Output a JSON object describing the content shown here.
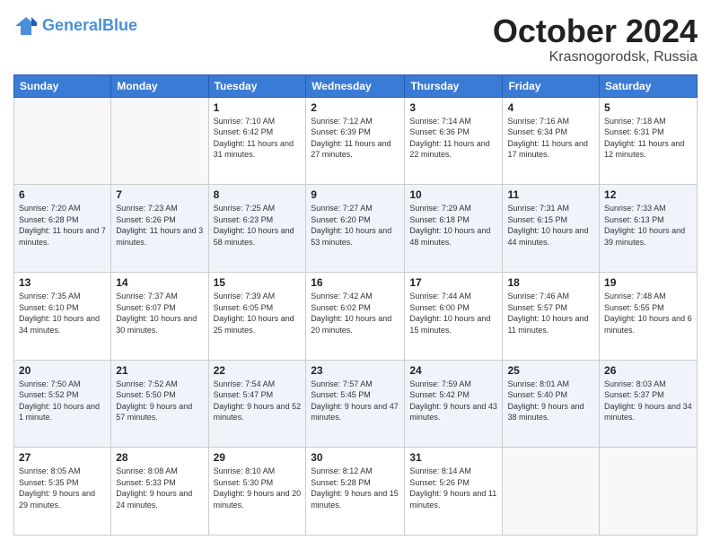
{
  "header": {
    "logo_line1": "General",
    "logo_line2": "Blue",
    "month": "October 2024",
    "location": "Krasnogorodsk, Russia"
  },
  "weekdays": [
    "Sunday",
    "Monday",
    "Tuesday",
    "Wednesday",
    "Thursday",
    "Friday",
    "Saturday"
  ],
  "weeks": [
    [
      {
        "day": "",
        "info": ""
      },
      {
        "day": "",
        "info": ""
      },
      {
        "day": "1",
        "info": "Sunrise: 7:10 AM\nSunset: 6:42 PM\nDaylight: 11 hours\nand 31 minutes."
      },
      {
        "day": "2",
        "info": "Sunrise: 7:12 AM\nSunset: 6:39 PM\nDaylight: 11 hours\nand 27 minutes."
      },
      {
        "day": "3",
        "info": "Sunrise: 7:14 AM\nSunset: 6:36 PM\nDaylight: 11 hours\nand 22 minutes."
      },
      {
        "day": "4",
        "info": "Sunrise: 7:16 AM\nSunset: 6:34 PM\nDaylight: 11 hours\nand 17 minutes."
      },
      {
        "day": "5",
        "info": "Sunrise: 7:18 AM\nSunset: 6:31 PM\nDaylight: 11 hours\nand 12 minutes."
      }
    ],
    [
      {
        "day": "6",
        "info": "Sunrise: 7:20 AM\nSunset: 6:28 PM\nDaylight: 11 hours\nand 7 minutes."
      },
      {
        "day": "7",
        "info": "Sunrise: 7:23 AM\nSunset: 6:26 PM\nDaylight: 11 hours\nand 3 minutes."
      },
      {
        "day": "8",
        "info": "Sunrise: 7:25 AM\nSunset: 6:23 PM\nDaylight: 10 hours\nand 58 minutes."
      },
      {
        "day": "9",
        "info": "Sunrise: 7:27 AM\nSunset: 6:20 PM\nDaylight: 10 hours\nand 53 minutes."
      },
      {
        "day": "10",
        "info": "Sunrise: 7:29 AM\nSunset: 6:18 PM\nDaylight: 10 hours\nand 48 minutes."
      },
      {
        "day": "11",
        "info": "Sunrise: 7:31 AM\nSunset: 6:15 PM\nDaylight: 10 hours\nand 44 minutes."
      },
      {
        "day": "12",
        "info": "Sunrise: 7:33 AM\nSunset: 6:13 PM\nDaylight: 10 hours\nand 39 minutes."
      }
    ],
    [
      {
        "day": "13",
        "info": "Sunrise: 7:35 AM\nSunset: 6:10 PM\nDaylight: 10 hours\nand 34 minutes."
      },
      {
        "day": "14",
        "info": "Sunrise: 7:37 AM\nSunset: 6:07 PM\nDaylight: 10 hours\nand 30 minutes."
      },
      {
        "day": "15",
        "info": "Sunrise: 7:39 AM\nSunset: 6:05 PM\nDaylight: 10 hours\nand 25 minutes."
      },
      {
        "day": "16",
        "info": "Sunrise: 7:42 AM\nSunset: 6:02 PM\nDaylight: 10 hours\nand 20 minutes."
      },
      {
        "day": "17",
        "info": "Sunrise: 7:44 AM\nSunset: 6:00 PM\nDaylight: 10 hours\nand 15 minutes."
      },
      {
        "day": "18",
        "info": "Sunrise: 7:46 AM\nSunset: 5:57 PM\nDaylight: 10 hours\nand 11 minutes."
      },
      {
        "day": "19",
        "info": "Sunrise: 7:48 AM\nSunset: 5:55 PM\nDaylight: 10 hours\nand 6 minutes."
      }
    ],
    [
      {
        "day": "20",
        "info": "Sunrise: 7:50 AM\nSunset: 5:52 PM\nDaylight: 10 hours\nand 1 minute."
      },
      {
        "day": "21",
        "info": "Sunrise: 7:52 AM\nSunset: 5:50 PM\nDaylight: 9 hours\nand 57 minutes."
      },
      {
        "day": "22",
        "info": "Sunrise: 7:54 AM\nSunset: 5:47 PM\nDaylight: 9 hours\nand 52 minutes."
      },
      {
        "day": "23",
        "info": "Sunrise: 7:57 AM\nSunset: 5:45 PM\nDaylight: 9 hours\nand 47 minutes."
      },
      {
        "day": "24",
        "info": "Sunrise: 7:59 AM\nSunset: 5:42 PM\nDaylight: 9 hours\nand 43 minutes."
      },
      {
        "day": "25",
        "info": "Sunrise: 8:01 AM\nSunset: 5:40 PM\nDaylight: 9 hours\nand 38 minutes."
      },
      {
        "day": "26",
        "info": "Sunrise: 8:03 AM\nSunset: 5:37 PM\nDaylight: 9 hours\nand 34 minutes."
      }
    ],
    [
      {
        "day": "27",
        "info": "Sunrise: 8:05 AM\nSunset: 5:35 PM\nDaylight: 9 hours\nand 29 minutes."
      },
      {
        "day": "28",
        "info": "Sunrise: 8:08 AM\nSunset: 5:33 PM\nDaylight: 9 hours\nand 24 minutes."
      },
      {
        "day": "29",
        "info": "Sunrise: 8:10 AM\nSunset: 5:30 PM\nDaylight: 9 hours\nand 20 minutes."
      },
      {
        "day": "30",
        "info": "Sunrise: 8:12 AM\nSunset: 5:28 PM\nDaylight: 9 hours\nand 15 minutes."
      },
      {
        "day": "31",
        "info": "Sunrise: 8:14 AM\nSunset: 5:26 PM\nDaylight: 9 hours\nand 11 minutes."
      },
      {
        "day": "",
        "info": ""
      },
      {
        "day": "",
        "info": ""
      }
    ]
  ]
}
